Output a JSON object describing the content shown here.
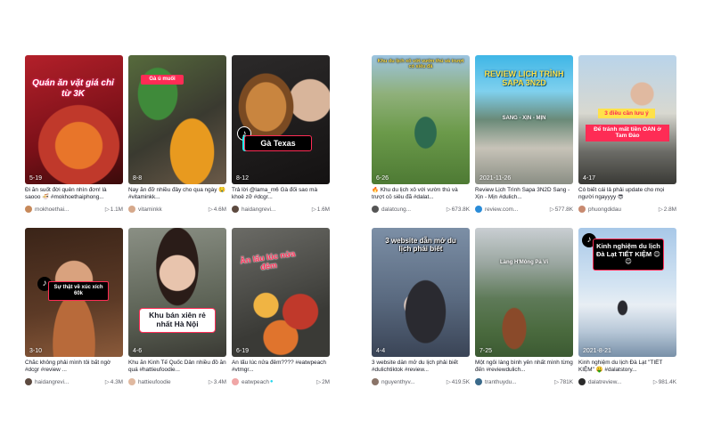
{
  "left": [
    {
      "overlay": "Quán ăn vặt giá chỉ từ 3K",
      "date": "5-19",
      "caption": "Đi ăn suốt đời quên nhìn đơn! là saooo 🍜 #mokhoethaiphong...",
      "user": "mokhoethai...",
      "verified": false,
      "plays": "1.1M"
    },
    {
      "overlay": "Gà ú muối",
      "date": "8-8",
      "caption": "Nay ăn đỡ nhiều đây cho qua ngày 🤤 #vitaminkk...",
      "user": "vitaminkk",
      "verified": false,
      "plays": "4.6M"
    },
    {
      "overlay": "Gà Texas",
      "date": "8-12",
      "caption": "Trả lời @lama_m6 Gà đối sao mà khoẻ zỡ #dcgr...",
      "user": "haidangrevi...",
      "verified": false,
      "plays": "1.6M"
    },
    {
      "overlay": "Sự thật về xúc xích 60k",
      "date": "3-10",
      "caption": "Chắc không phải mình tôi bất ngờ #dcgr #review ...",
      "user": "haidangrevi...",
      "verified": false,
      "plays": "4.3M"
    },
    {
      "overlay": "Khu bán xiên rẻ nhất Hà Nội",
      "date": "4-6",
      "caption": "Khu ăn Kinh Tế Quốc Dân nhiều đồ ăn quá #hattieufoodie...",
      "user": "hattieufoodie",
      "verified": false,
      "plays": "3.4M"
    },
    {
      "overlay": "Ăn lẩu lúc nửa đêm",
      "date": "6-19",
      "caption": "Ăn lẩu lúc nửa đêm???? #eatwpeach #vtmgr...",
      "user": "eatwpeach",
      "verified": true,
      "plays": "2M"
    }
  ],
  "right": [
    {
      "overlay": "Khu du lịch xô với vườn thú và trượt cỏ siêu đã",
      "date": "6-26",
      "caption": "🔥 Khu du lịch xô với vườn thú và trượt cỏ siêu đã #dalat...",
      "user": "dalatcung...",
      "verified": false,
      "plays": "673.8K"
    },
    {
      "overlay": "REVIEW LỊCH TRÌNH SAPA 3N2D",
      "overlay2": "SANG - XỊN - MỊN",
      "date": "2021-11-26",
      "caption": "Review Lịch Trình Sapa 3N2D Sang - Xịn - Mịn #dulich...",
      "user": "review.com...",
      "verified": false,
      "plays": "577.8K"
    },
    {
      "overlay": "3 điều cần lưu ý",
      "overlay2": "Để tránh mất tiền OAN ở Tam Đảo",
      "date": "4-17",
      "caption": "Có biết cái lả phải update cho mọi người ngayyyy 😎",
      "user": "phuongdidau",
      "verified": false,
      "plays": "2.8M"
    },
    {
      "overlay": "3 website dẫn mở du lịch phải biết",
      "date": "4-4",
      "caption": "3 website dẫn mở du lịch phải biết #dulichtiktok #review...",
      "user": "nguyenthyv...",
      "verified": false,
      "plays": "419.5K"
    },
    {
      "overlay": "Làng H'Mông Pả Vi",
      "date": "7-25",
      "caption": "Một ngôi làng bình yên nhất mình từng đến #reviewdulich...",
      "user": "tranthuydu...",
      "verified": false,
      "plays": "781K"
    },
    {
      "overlay": "Kinh nghiệm du lịch Đà Lạt TIẾT KIỆM 😊😊",
      "date": "2021-8-21",
      "caption": "Kinh nghiệm du lịch Đà Lạt \"TIẾT KIỆM\" 🤑 #dalatstory...",
      "user": "dalatreview...",
      "verified": false,
      "plays": "981.4K"
    }
  ],
  "icons": {
    "play": "▷",
    "verified": "●",
    "logo": "♪"
  },
  "colors": {
    "pink": "#fe2c55",
    "cyan": "#25f4ee",
    "verified": "#20d5ec"
  }
}
